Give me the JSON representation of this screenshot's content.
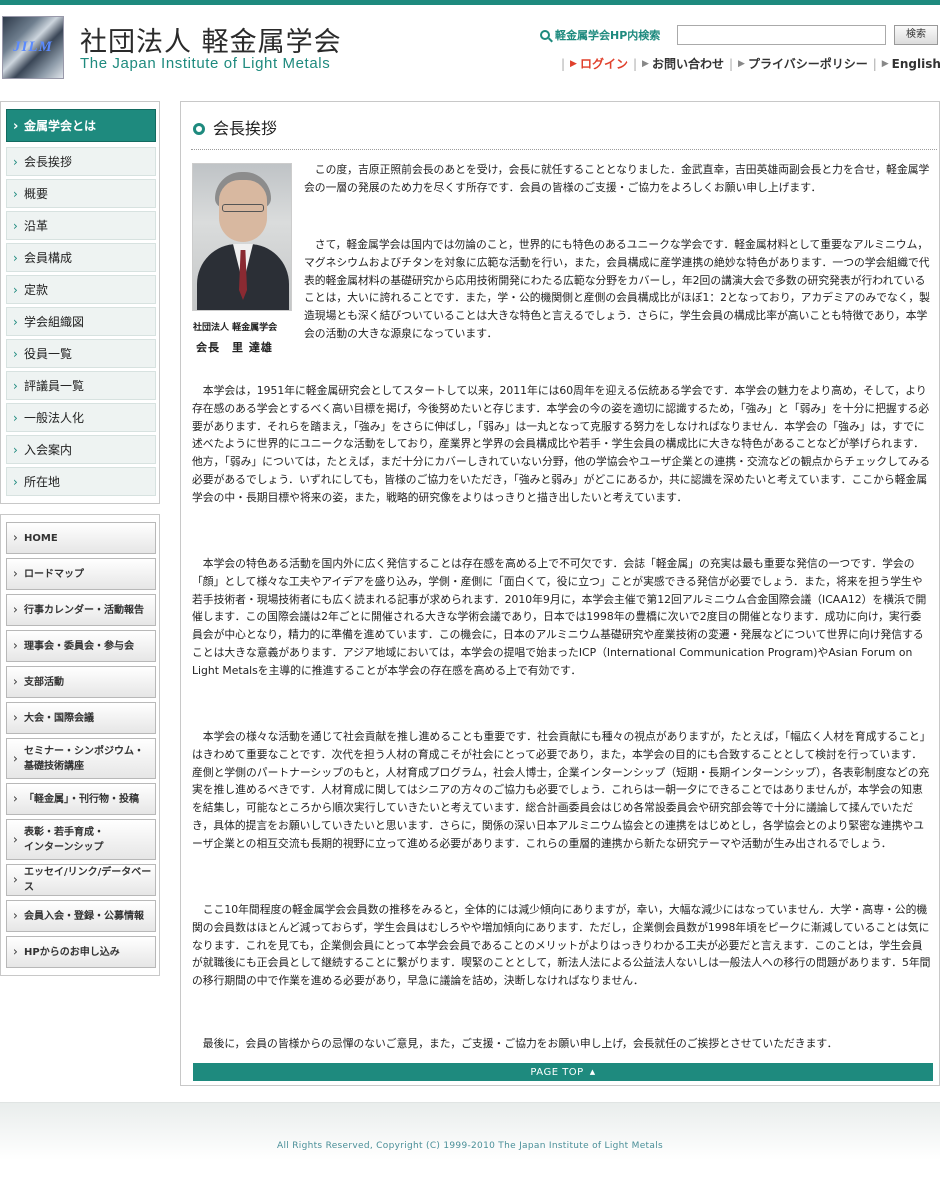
{
  "header": {
    "logo_text": "JILM",
    "title_ja": "社団法人 軽金属学会",
    "title_en": "The Japan Institute of Light Metals",
    "search_label": "軽金属学会HP内検索",
    "search_value": "",
    "search_button": "検索",
    "util_links": [
      "ログイン",
      "お問い合わせ",
      "プライバシーポリシー",
      "English"
    ]
  },
  "sidebar": {
    "section_title": "金属学会とは",
    "items": [
      "会長挨拶",
      "概要",
      "沿革",
      "会員構成",
      "定款",
      "学会組織図",
      "役員一覧",
      "評議員一覧",
      "一般法人化",
      "入会案内",
      "所在地"
    ],
    "global_nav": [
      {
        "label": "HOME",
        "label2": ""
      },
      {
        "label": "ロードマップ",
        "label2": ""
      },
      {
        "label": "行事カレンダー・活動報告",
        "label2": ""
      },
      {
        "label": "理事会・委員会・参与会",
        "label2": ""
      },
      {
        "label": "支部活動",
        "label2": ""
      },
      {
        "label": "大会・国際会議",
        "label2": ""
      },
      {
        "label": "セミナー・シンポジウム・",
        "label2": "基礎技術講座"
      },
      {
        "label": "「軽金属」・刊行物・投稿",
        "label2": ""
      },
      {
        "label": "表彰・若手育成・",
        "label2": "インターンシップ"
      },
      {
        "label": "エッセイ/リンク/データベース",
        "label2": ""
      },
      {
        "label": "会員入会・登録・公募情報",
        "label2": ""
      },
      {
        "label": "HPからのお申し込み",
        "label2": ""
      }
    ]
  },
  "main": {
    "heading": "会長挨拶",
    "photo_caption_org": "社団法人 軽金属学会",
    "photo_caption_name": "会長　里 達雄",
    "paragraphs": [
      "この度，吉原正照前会長のあとを受け，会長に就任することとなりました．金武直幸，吉田英雄両副会長と力を合せ，軽金属学会の一層の発展のため力を尽くす所存です．会員の皆様のご支援・ご協力をよろしくお願い申し上げます．",
      "さて，軽金属学会は国内では勿論のこと，世界的にも特色のあるユニークな学会です．軽金属材料として重要なアルミニウム，マグネシウムおよびチタンを対象に広範な活動を行い，また，会員構成に産学連携の絶妙な特色があります．一つの学会組織で代表的軽金属材料の基礎研究から応用技術開発にわたる広範な分野をカバーし，年2回の講演大会で多数の研究発表が行われていることは，大いに誇れることです．また，学・公的機関側と産側の会員構成比がほぼ1：2となっており，アカデミアのみでなく，製造現場とも深く結びついていることは大きな特色と言えるでしょう．さらに，学生会員の構成比率が高いことも特徴であり，本学会の活動の大きな源泉になっています．",
      "本学会は，1951年に軽金属研究会としてスタートして以来，2011年には60周年を迎える伝統ある学会です．本学会の魅力をより高め，そして，より存在感のある学会とするべく高い目標を掲げ，今後努めたいと存じます．本学会の今の姿を適切に認識するため，「強み」と「弱み」を十分に把握する必要があります．それらを踏まえ，「強み」をさらに伸ばし，「弱み」は一丸となって克服する努力をしなければなりません．本学会の「強み」は，すでに述べたように世界的にユニークな活動をしており，産業界と学界の会員構成比や若手・学生会員の構成比に大きな特色があることなどが挙げられます．他方，「弱み」については，たとえば，まだ十分にカバーしきれていない分野，他の学協会やユーザ企業との連携・交流などの観点からチェックしてみる必要があるでしょう．いずれにしても，皆様のご協力をいただき，「強みと弱み」がどこにあるか，共に認識を深めたいと考えています．ここから軽金属学会の中・長期目標や将来の姿，また，戦略的研究像をよりはっきりと描き出したいと考えています．",
      "本学会の特色ある活動を国内外に広く発信することは存在感を高める上で不可欠です．会誌「軽金属」の充実は最も重要な発信の一つです．学会の「顔」として様々な工夫やアイデアを盛り込み，学側・産側に「面白くて，役に立つ」ことが実感できる発信が必要でしょう．また，将来を担う学生や若手技術者・現場技術者にも広く読まれる記事が求められます．2010年9月に，本学会主催で第12回アルミニウム合金国際会議（ICAA12）を横浜で開催します．この国際会議は2年ごとに開催される大きな学術会議であり，日本では1998年の豊橋に次いで2度目の開催となります．成功に向け，実行委員会が中心となり，精力的に準備を進めています．この機会に，日本のアルミニウム基礎研究や産業技術の変遷・発展などについて世界に向け発信することは大きな意義があります．アジア地域においては，本学会の提唱で始まったICP（International Communication Program)やAsian Forum on Light Metalsを主導的に推進することが本学会の存在感を高める上で有効です．",
      "本学会の様々な活動を通じて社会貢献を推し進めることも重要です．社会貢献にも種々の視点がありますが，たとえば，「幅広く人材を育成すること」はきわめて重要なことです．次代を担う人材の育成こそが社会にとって必要であり，また，本学会の目的にも合致することとして検討を行っています．産側と学側のパートナーシップのもと，人材育成プログラム，社会人博士，企業インターンシップ（短期・長期インターンシップ），各表彰制度などの充実を推し進めるべきです．人材育成に関してはシニアの方々のご協力も必要でしょう．これらは一朝一夕にできることではありませんが，本学会の知恵を結集し，可能なところから順次実行していきたいと考えています．総合計画委員会はじめ各常設委員会や研究部会等で十分に議論して揉んでいただき，具体的提言をお願いしていきたいと思います．さらに，関係の深い日本アルミニウム協会との連携をはじめとし，各学協会とのより緊密な連携やユーザ企業との相互交流も長期的視野に立って進める必要があります．これらの重層的連携から新たな研究テーマや活動が生み出されるでしょう．",
      "ここ10年間程度の軽金属学会会員数の推移をみると，全体的には減少傾向にありますが，幸い，大幅な減少にはなっていません．大学・高専・公的機関の会員数はほとんど減っておらず，学生会員はむしろやや増加傾向にあります．ただし，企業側会員数が1998年頃をピークに漸減していることは気になります．これを見ても，企業側会員にとって本学会会員であることのメリットがよりはっきりわかる工夫が必要だと言えます．このことは，学生会員が就職後にも正会員として継続することに繋がります．喫緊のこととして，新法人法による公益法人ないしは一般法人への移行の問題があります．5年間の移行期間の中で作業を進める必要があり，早急に議論を詰め，決断しなければなりません．",
      "最後に，会員の皆様からの忌憚のないご意見，また，ご支援・ご協力をお願い申し上げ，会長就任のご挨拶とさせていただきます．"
    ],
    "page_top": "PAGE TOP"
  },
  "footer": {
    "copyright": "All Rights Reserved, Copyright (C) 1999-2010 The Japan Institute of Light Metals"
  },
  "colors": {
    "accent": "#1e8a7e",
    "login": "#e0402c",
    "footer_text": "#4a8f98"
  }
}
